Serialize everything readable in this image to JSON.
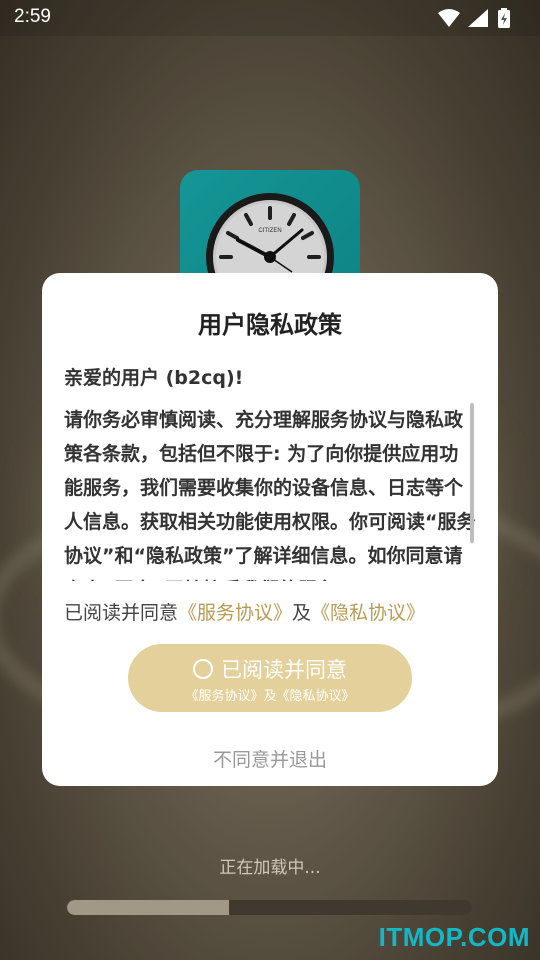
{
  "status_bar": {
    "time": "2:59",
    "icons": [
      "wifi-icon",
      "signal-icon",
      "battery-charging-icon"
    ]
  },
  "app_icon": {
    "icon": "alarm-clock-icon",
    "brand_text": "CITIZEN",
    "color": "#149a9b"
  },
  "dialog": {
    "title": "用户隐私政策",
    "greeting": "亲爱的用户 (b2cq)!",
    "body": "请你务必审慎阅读、充分理解服务协议与隐私政策各条款，包括但不限于: 为了向你提供应用功能服务，我们需要收集你的设备信息、日志等个人信息。获取相关功能使用权限。你可阅读“服务协议”和“隐私政策”了解详细信息。如你同意请点击“同意”开始接受我们的服务。",
    "agree_prefix": "已阅读并同意",
    "service_link": "《服务协议》",
    "conjunction": "及",
    "privacy_link": "《隐私协议》",
    "agree_button_label": "已阅读并同意",
    "agree_button_sub": "《服务协议》及《隐私协议》",
    "disagree_label": "不同意并退出",
    "accent_color": "#b99a55",
    "button_color": "#e3d09a"
  },
  "loading": {
    "text": "正在加载中...",
    "progress": 0.4
  },
  "watermark": "ITMOP.COM"
}
